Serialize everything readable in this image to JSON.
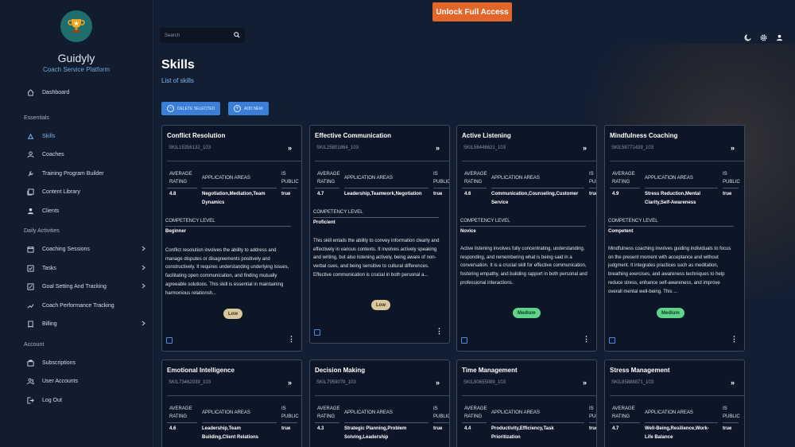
{
  "brand": {
    "name": "Guidyly",
    "subtitle": "Coach Service Platform"
  },
  "sidebar": {
    "top": [
      {
        "label": "Dashboard",
        "icon": "home-icon"
      }
    ],
    "essentials_title": "Essentials",
    "essentials": [
      {
        "label": "Skills",
        "icon": "skills-icon",
        "active": true
      },
      {
        "label": "Coaches",
        "icon": "user-icon"
      },
      {
        "label": "Training Program Builder",
        "icon": "wrench-icon"
      },
      {
        "label": "Content Library",
        "icon": "library-icon"
      },
      {
        "label": "Clients",
        "icon": "clients-icon"
      }
    ],
    "daily_title": "Daily Activities",
    "daily": [
      {
        "label": "Coaching Sessions",
        "icon": "calendar-icon",
        "expand": true
      },
      {
        "label": "Tasks",
        "icon": "checkbox-icon",
        "expand": true
      },
      {
        "label": "Goal Setting And Tracking",
        "icon": "pencil-icon",
        "expand": true
      },
      {
        "label": "Coach Performance Tracking",
        "icon": "trend-icon"
      },
      {
        "label": "Billing",
        "icon": "receipt-icon",
        "expand": true
      }
    ],
    "account_title": "Account",
    "account": [
      {
        "label": "Subscriptions",
        "icon": "subscriptions-icon"
      },
      {
        "label": "User Accounts",
        "icon": "users-icon"
      },
      {
        "label": "Log Out",
        "icon": "logout-icon"
      }
    ]
  },
  "header": {
    "unlock_label": "Unlock Full Access",
    "search_placeholder": "Search"
  },
  "page": {
    "title": "Skills",
    "subtitle": "List of skills",
    "delete_label": "DELETE SELECTED",
    "add_label": "ADD NEW"
  },
  "labels": {
    "avg_rating_1": "AVERAGE",
    "avg_rating_2": "RATING",
    "app_areas": "APPLICATION AREAS",
    "is_public_1": "IS",
    "is_public_2": "PUBLIC",
    "competency": "COMPETENCY LEVEL"
  },
  "cards": [
    {
      "title": "Conflict Resolution",
      "code": "SKIL15356132_103",
      "rating": "4.8",
      "areas": [
        "Negotiation,Mediation,Team",
        "Dynamics"
      ],
      "public": "true",
      "level": "Beginner",
      "desc": "Conflict resolution involves the ability to address and manage disputes or disagreements positively and constructively. It requires understanding underlying issues, facilitating open communication, and finding mutually agreeable solutions. This skill is essential in maintaining harmonious relationsh...",
      "badge": "Low"
    },
    {
      "title": "Effective Communication",
      "code": "SKIL25801864_103",
      "rating": "4.7",
      "areas": [
        "Leadership,Teamwork,Negotiation"
      ],
      "public": "true",
      "level": "Proficient",
      "desc": "This skill entails the ability to convey information clearly and effectively in various contexts. It involves actively speaking and writing, but also listening actively, being aware of non-verbal cues, and being sensitive to cultural differences. Effective communication is crucial in both personal a...",
      "badge": "Low"
    },
    {
      "title": "Active Listening",
      "code": "SKIL56446621_103",
      "rating": "4.6",
      "areas": [
        "Communication,Counseling,Customer",
        "Service"
      ],
      "public": "true",
      "level": "Novice",
      "desc": "Active listening involves fully concentrating, understanding, responding, and remembering what is being said in a conversation. It is a crucial skill for effective communication, fostering empathy, and building rapport in both personal and professional interactions.",
      "badge": "Medium"
    },
    {
      "title": "Mindfulness Coaching",
      "code": "SKIL56771439_103",
      "rating": "4.9",
      "areas": [
        "Stress Reduction,Mental",
        "Clarity,Self-Awareness"
      ],
      "public": "true",
      "level": "Competent",
      "desc": "Mindfulness coaching involves guiding individuals to focus on the present moment with acceptance and without judgment. It integrates practices such as meditation, breathing exercises, and awareness techniques to help reduce stress, enhance self-awareness, and improve overall mental well-being. This ...",
      "badge": "Medium"
    },
    {
      "title": "Emotional Intelligence",
      "code": "SKIL73462039_103",
      "rating": "4.6",
      "areas": [
        "Leadership,Team",
        "Building,Client Relations"
      ],
      "public": "true"
    },
    {
      "title": "Decision Making",
      "code": "SKIL7959079_103",
      "rating": "4.3",
      "areas": [
        "Strategic Planning,Problem",
        "Solving,Leadership"
      ],
      "public": "true"
    },
    {
      "title": "Time Management",
      "code": "SKIL80655089_103",
      "rating": "4.4",
      "areas": [
        "Productivity,Efficiency,Task",
        "Prioritization"
      ],
      "public": "true"
    },
    {
      "title": "Stress Management",
      "code": "SKIL85888871_103",
      "rating": "4.7",
      "areas": [
        "Well-Being,Resilience,Work-",
        "Life Balance"
      ],
      "public": "true"
    }
  ]
}
